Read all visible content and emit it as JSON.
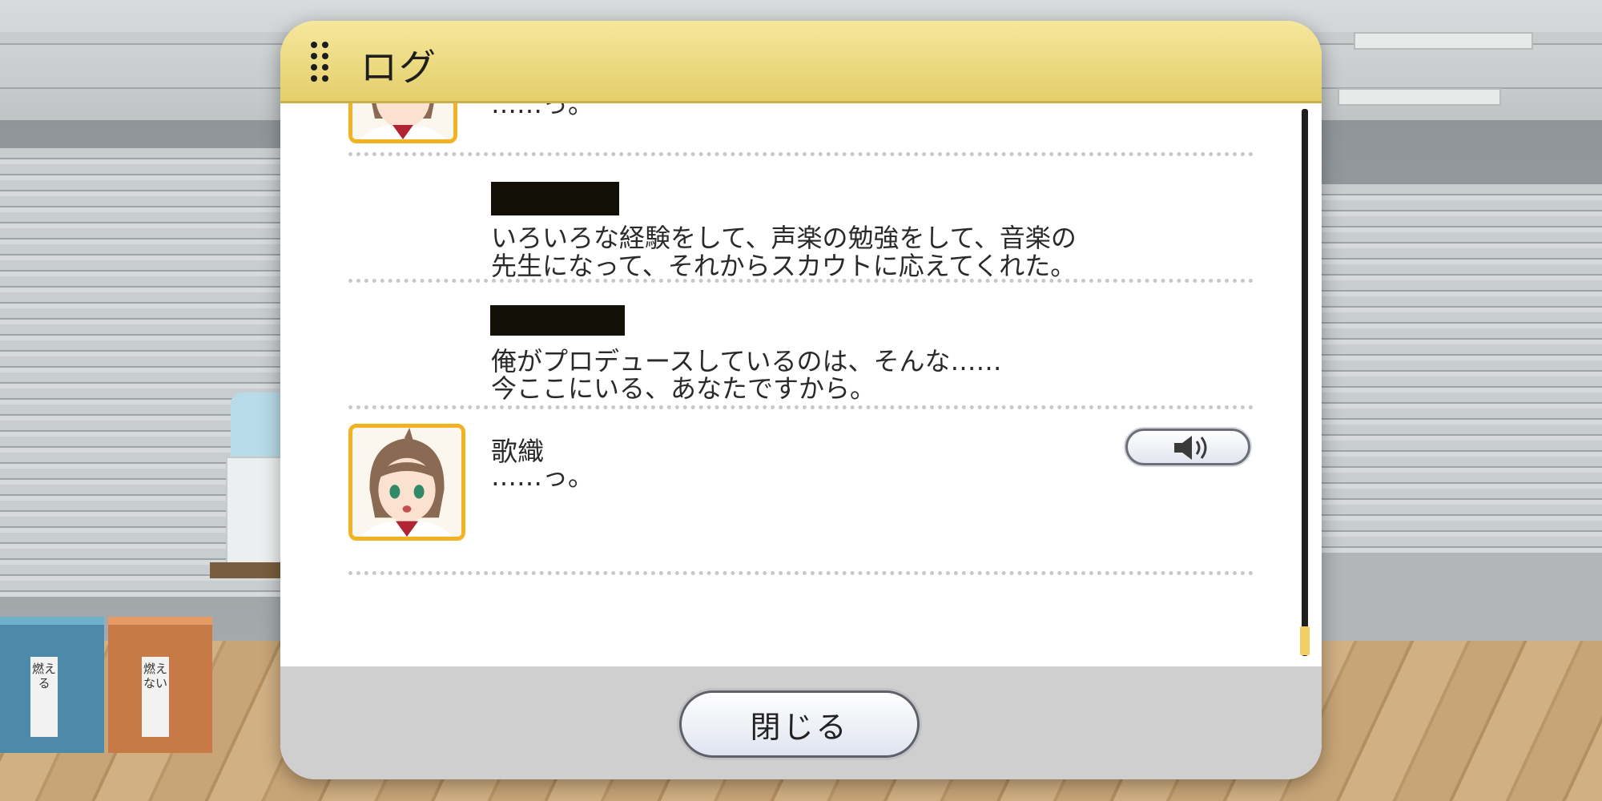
{
  "window": {
    "title": "ログ"
  },
  "log": {
    "entries": [
      {
        "speaker": "",
        "text": "……っ。",
        "has_avatar": true,
        "partial": true
      },
      {
        "speaker": "",
        "speaker_redacted": true,
        "line1": "いろいろな経験をして、声楽の勉強をして、音楽の",
        "line2": "先生になって、それからスカウトに応えてくれた。"
      },
      {
        "speaker": "",
        "speaker_redacted": true,
        "line1": "俺がプロデュースしているのは、そんな……",
        "line2": "今ここにいる、あなたですから。"
      },
      {
        "speaker": "歌織",
        "text": "……っ。",
        "has_avatar": true,
        "voice_icon": "speaker-volume-icon"
      }
    ]
  },
  "footer": {
    "close_label": "閉じる"
  },
  "background": {
    "bin_left_label": "燃える",
    "bin_right_label": "燃えない"
  },
  "colors": {
    "header": "#e8d57a",
    "avatar_border": "#f2b222",
    "scroll_thumb": "#f0d064",
    "redaction": "#131008"
  }
}
